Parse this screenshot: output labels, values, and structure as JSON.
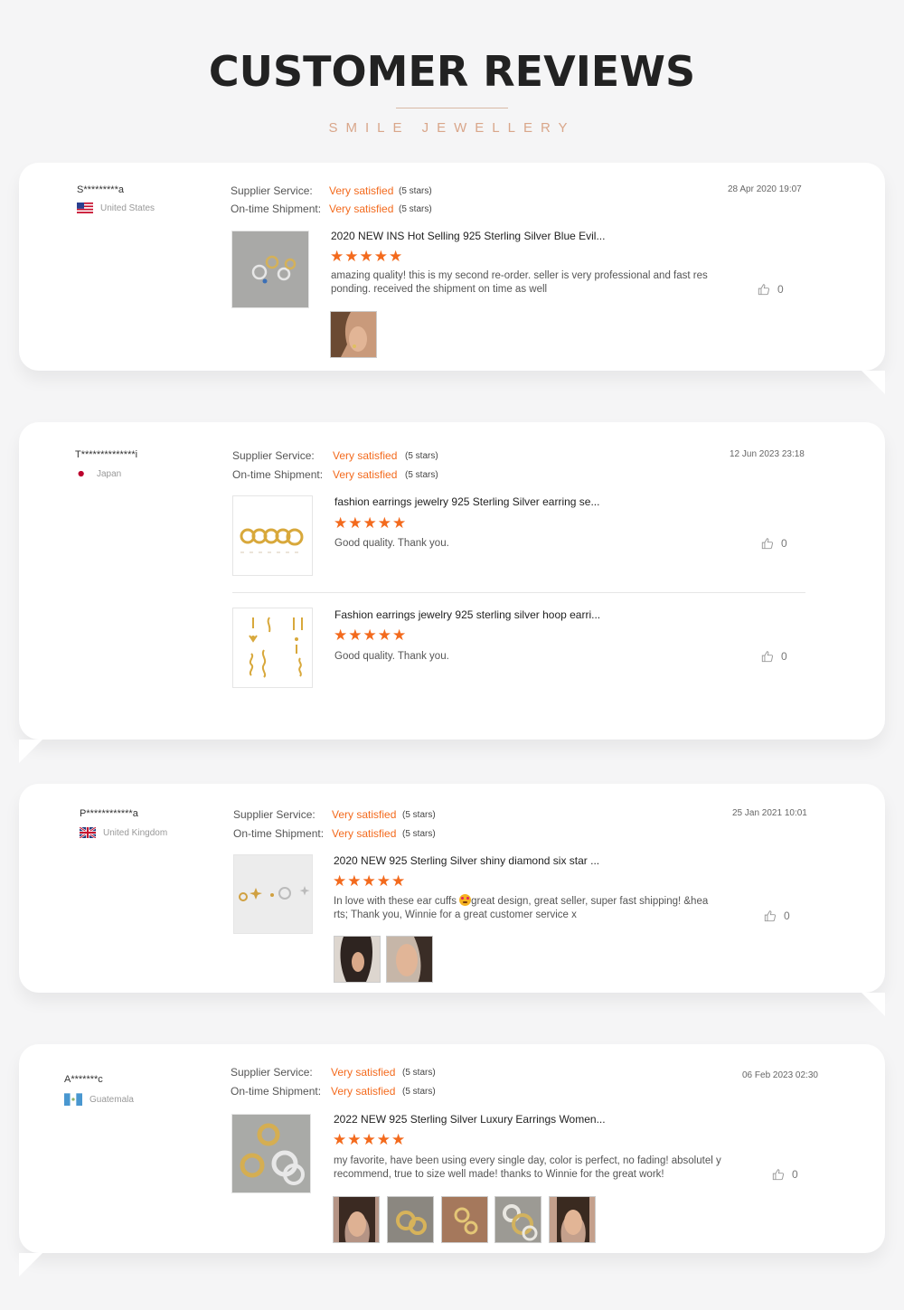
{
  "header": {
    "title": "CUSTOMER REVIEWS",
    "subtitle": "SMILE JEWELLERY"
  },
  "common": {
    "service_label": "Supplier Service:",
    "shipment_label": "On-time Shipment:",
    "very_satisfied": "Very satisfied",
    "five_stars": "(5 stars)",
    "star_row": "★★★★★"
  },
  "reviews": [
    {
      "user": "S*********a",
      "country": "United States",
      "date": "28 Apr 2020 19:07",
      "items": [
        {
          "title": "2020 NEW INS Hot Selling 925 Sterling Silver Blue Evil...",
          "text": "amazing quality! this is my second re-order. seller is very professional and fast res ponding. received the shipment on time as well",
          "likes": "0"
        }
      ]
    },
    {
      "user": "T**************i",
      "country": "Japan",
      "date": "12 Jun 2023 23:18",
      "items": [
        {
          "title": "fashion earrings jewelry 925 Sterling Silver earring se...",
          "text": "Good quality. Thank you.",
          "likes": "0"
        },
        {
          "title": "Fashion earrings jewelry 925 sterling silver hoop earri...",
          "text": "Good quality. Thank you.",
          "likes": "0"
        }
      ]
    },
    {
      "user": "P************a",
      "country": "United Kingdom",
      "date": "25 Jan 2021 10:01",
      "items": [
        {
          "title": "2020 NEW 925 Sterling Silver shiny diamond six star ...",
          "text_a": "In love with these ear cuffs ",
          "text_b": "great design, great seller, super fast shipping! &hea rts; Thank you, Winnie for a great customer service x",
          "likes": "0"
        }
      ]
    },
    {
      "user": "A*******c",
      "country": "Guatemala",
      "date": "06 Feb 2023 02:30",
      "items": [
        {
          "title": "2022 NEW 925 Sterling Silver Luxury Earrings Women...",
          "text": "my favorite, have been using every single day, color is perfect, no fading! absolutel y recommend, true to size well made! thanks to Winnie for the great work!",
          "likes": "0"
        }
      ]
    }
  ],
  "colors": {
    "accent": "#f36a1d",
    "subtitle": "#d9a68a",
    "background": "#f5f5f6"
  }
}
